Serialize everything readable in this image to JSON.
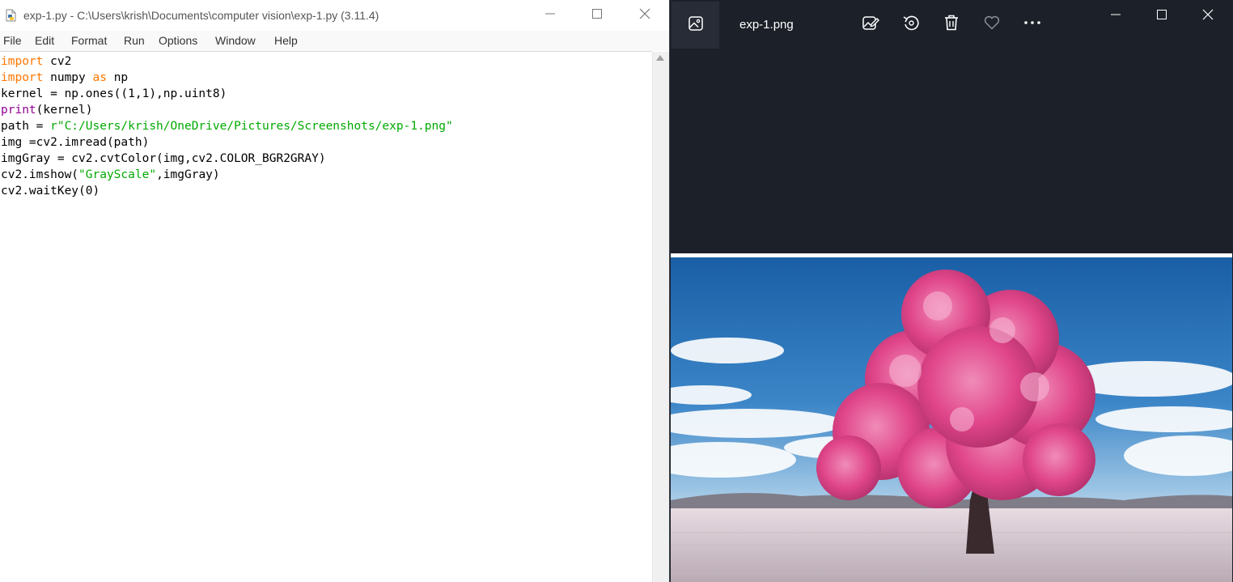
{
  "idle": {
    "title": "exp-1.py - C:\\Users\\krish\\Documents\\computer vision\\exp-1.py (3.11.4)",
    "menu": [
      "File",
      "Edit",
      "Format",
      "Run",
      "Options",
      "Window",
      "Help"
    ],
    "code_lines": [
      "import cv2",
      "import numpy as np",
      "kernel = np.ones((1,1),np.uint8)",
      "print(kernel)",
      "path = r\"C:/Users/krish/OneDrive/Pictures/Screenshots/exp-1.png\"",
      "img =cv2.imread(path)",
      "imgGray = cv2.cvtColor(img,cv2.COLOR_BGR2GRAY)",
      "cv2.imshow(\"GrayScale\",imgGray)",
      "cv2.waitKey(0)"
    ],
    "colors": {
      "keyword": "#ff7700",
      "builtin": "#900090",
      "string": "#00aa00"
    },
    "window_icons": [
      "python-file-icon",
      "minimize-icon",
      "maximize-icon",
      "close-icon"
    ]
  },
  "photos": {
    "filename": "exp-1.png",
    "toolbar_icons": [
      "gallery-icon",
      "edit-image-icon",
      "rotate-icon",
      "delete-icon",
      "favorite-heart-icon",
      "more-options-icon"
    ],
    "window_icons": [
      "minimize-icon",
      "maximize-icon",
      "close-icon"
    ],
    "image_subject": "pink-blossom-tree",
    "colors": {
      "background": "#1c2029",
      "tree": "#e0458a",
      "sky": "#1f6fb8"
    }
  }
}
